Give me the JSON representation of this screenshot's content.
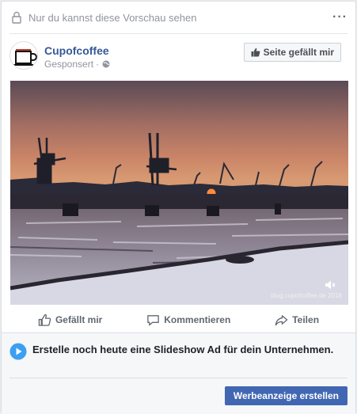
{
  "preview": {
    "text": "Nur du kannst diese Vorschau sehen",
    "more_icon": "more-options-icon"
  },
  "post": {
    "page_name": "Cupofcoffee",
    "sponsored_label": "Gesponsert",
    "separator": "·",
    "like_page_label": "Seite gefällt mir"
  },
  "media": {
    "watermark": "blog.cupofcoffee.de 2018"
  },
  "actions": {
    "like": "Gefällt mir",
    "comment": "Kommentieren",
    "share": "Teilen"
  },
  "cta": {
    "text": "Erstelle noch heute eine Slideshow Ad für dein Unternehmen.",
    "button": "Werbeanzeige erstellen"
  },
  "colors": {
    "brand_blue": "#4267b2",
    "link_blue": "#365899",
    "cta_play_blue": "#3b9ff2"
  }
}
